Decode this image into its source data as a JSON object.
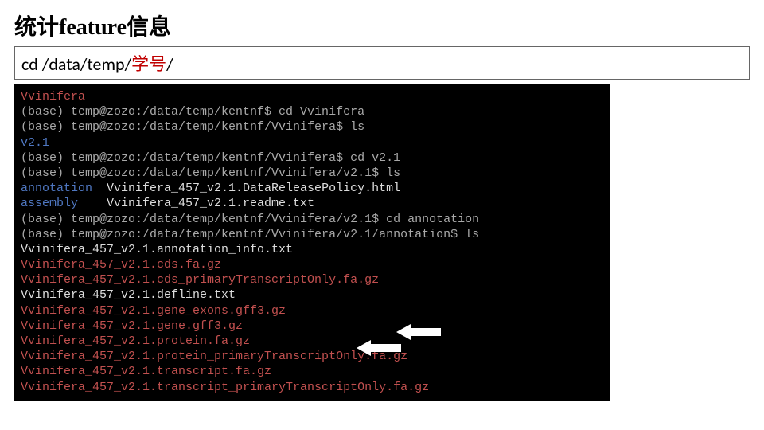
{
  "title": "统计feature信息",
  "command": {
    "prefix": "cd /data/temp/",
    "highlight": "学号",
    "suffix": "/"
  },
  "terminal": [
    {
      "cls": "c-red",
      "text": "Vvinifera"
    },
    {
      "cls": "c-lgray",
      "text": "(base) temp@zozo:/data/temp/kentnf$ cd Vvinifera"
    },
    {
      "cls": "c-lgray",
      "text": "(base) temp@zozo:/data/temp/kentnf/Vvinifera$ ls"
    },
    {
      "cls": "c-blue",
      "text": "v2.1"
    },
    {
      "cls": "c-lgray",
      "text": "(base) temp@zozo:/data/temp/kentnf/Vvinifera$ cd v2.1"
    },
    {
      "cls": "c-lgray",
      "text": "(base) temp@zozo:/data/temp/kentnf/Vvinifera/v2.1$ ls"
    },
    {
      "cls": "mix1",
      "a": "annotation",
      "b": "  Vvinifera_457_v2.1.DataReleasePolicy.html"
    },
    {
      "cls": "mix1",
      "a": "assembly",
      "b": "    Vvinifera_457_v2.1.readme.txt"
    },
    {
      "cls": "c-lgray",
      "text": "(base) temp@zozo:/data/temp/kentnf/Vvinifera/v2.1$ cd annotation"
    },
    {
      "cls": "c-lgray",
      "text": "(base) temp@zozo:/data/temp/kentnf/Vvinifera/v2.1/annotation$ ls"
    },
    {
      "cls": "c-white",
      "text": "Vvinifera_457_v2.1.annotation_info.txt"
    },
    {
      "cls": "c-red",
      "text": "Vvinifera_457_v2.1.cds.fa.gz"
    },
    {
      "cls": "c-red",
      "text": "Vvinifera_457_v2.1.cds_primaryTranscriptOnly.fa.gz"
    },
    {
      "cls": "c-white",
      "text": "Vvinifera_457_v2.1.defline.txt"
    },
    {
      "cls": "c-red",
      "text": "Vvinifera_457_v2.1.gene_exons.gff3.gz"
    },
    {
      "cls": "c-red",
      "text": "Vvinifera_457_v2.1.gene.gff3.gz"
    },
    {
      "cls": "c-red",
      "text": "Vvinifera_457_v2.1.protein.fa.gz"
    },
    {
      "cls": "c-red",
      "text": "Vvinifera_457_v2.1.protein_primaryTranscriptOnly.fa.gz"
    },
    {
      "cls": "c-red",
      "text": "Vvinifera_457_v2.1.transcript.fa.gz"
    },
    {
      "cls": "c-red",
      "text": "Vvinifera_457_v2.1.transcript_primaryTranscriptOnly.fa.gz"
    }
  ]
}
